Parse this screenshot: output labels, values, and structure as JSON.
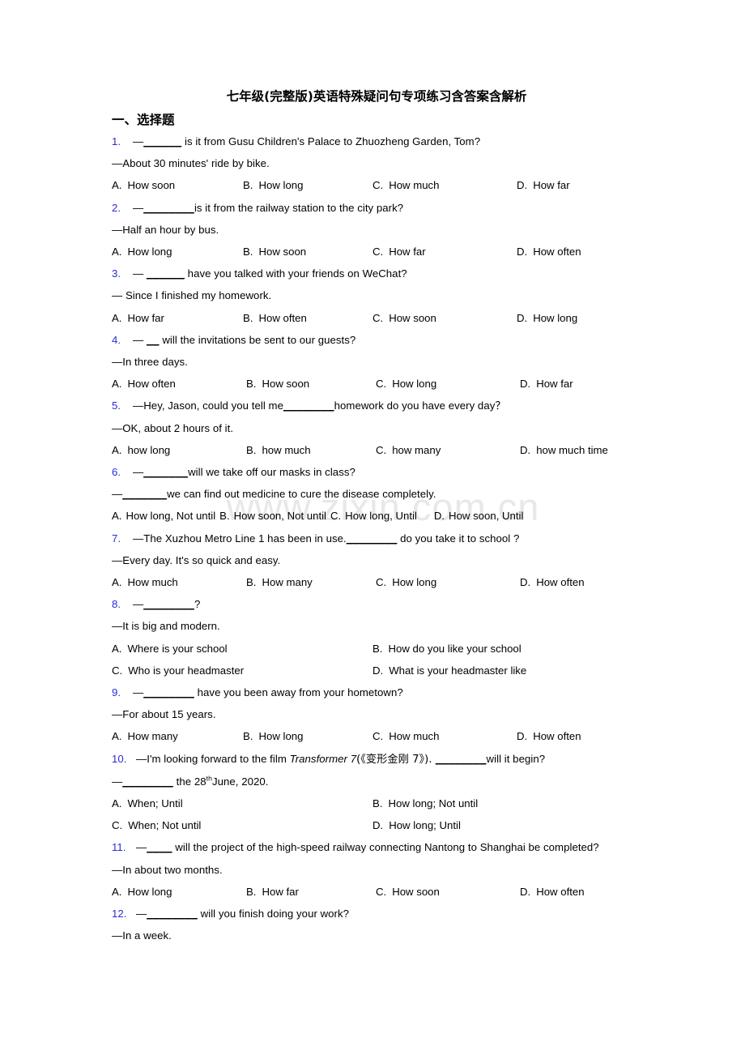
{
  "document": {
    "title": "七年级(完整版)英语特殊疑问句专项练习含答案含解析",
    "section_heading": "一、选择题",
    "watermark": "www.zixin.com.cn",
    "accent_color": "#2b2bd4"
  },
  "questions": [
    {
      "number": "1.",
      "stem": "—______ is it from Gusu Children's Palace to Zhuozheng Garden, Tom?",
      "stem_prefix": "—",
      "stem_blank": "______",
      "stem_rest": " is it from Gusu Children's Palace to Zhuozheng Garden, Tom?",
      "answer_line": "—About 30 minutes' ride by bike.",
      "layout": "four-column",
      "options": [
        {
          "label": "A.",
          "text": "How soon"
        },
        {
          "label": "B.",
          "text": "How long"
        },
        {
          "label": "C.",
          "text": "How much"
        },
        {
          "label": "D.",
          "text": "How far"
        }
      ]
    },
    {
      "number": "2.",
      "stem_prefix": "—",
      "stem_blank": "________",
      "stem_rest": "is it from the railway station to the city park?",
      "answer_line": "—Half an hour by bus.",
      "layout": "four-column",
      "options": [
        {
          "label": "A.",
          "text": "How long"
        },
        {
          "label": "B.",
          "text": "How soon"
        },
        {
          "label": "C.",
          "text": "How far"
        },
        {
          "label": "D.",
          "text": "How often"
        }
      ]
    },
    {
      "number": "3.",
      "stem_prefix": "— ",
      "stem_blank": "______",
      "stem_rest": " have you talked with your friends on WeChat?",
      "answer_line": "— Since I finished my homework.",
      "layout": "four-column",
      "options": [
        {
          "label": "A.",
          "text": "How far"
        },
        {
          "label": "B.",
          "text": "How often"
        },
        {
          "label": "C.",
          "text": "How soon"
        },
        {
          "label": "D.",
          "text": "How long"
        }
      ]
    },
    {
      "number": "4.",
      "stem_prefix": "— ",
      "stem_blank": "__",
      "stem_rest": " will the invitations be sent to our guests?",
      "answer_line": "—In three days.",
      "layout": "four-column-indent",
      "options": [
        {
          "label": "A.",
          "text": "How often"
        },
        {
          "label": "B.",
          "text": "How soon"
        },
        {
          "label": "C.",
          "text": "How long"
        },
        {
          "label": "D.",
          "text": "How far"
        }
      ]
    },
    {
      "number": "5.",
      "stem_prefix": "—Hey, Jason, could you tell me",
      "stem_blank": "________",
      "stem_rest": "homework do you have every day？",
      "answer_line": "—OK, about 2 hours of it.",
      "layout": "four-column-indent",
      "options": [
        {
          "label": "A.",
          "text": "how long"
        },
        {
          "label": "B.",
          "text": "how much"
        },
        {
          "label": "C.",
          "text": "how many"
        },
        {
          "label": "D.",
          "text": "how much time"
        }
      ]
    },
    {
      "number": "6.",
      "stem_prefix": "—",
      "stem_blank": "_______",
      "stem_rest": "will we take off our masks in class?",
      "answer_prefix": "—",
      "answer_blank": "_______",
      "answer_rest": "we can find out medicine to cure the disease completely.",
      "layout": "flow",
      "options": [
        {
          "label": "A.",
          "text": "How long, Not until"
        },
        {
          "label": "B.",
          "text": "How soon, Not until"
        },
        {
          "label": "C.",
          "text": "How long, Until"
        },
        {
          "label": "D.",
          "text": "How soon, Until"
        }
      ]
    },
    {
      "number": "7.",
      "stem_prefix": "—The Xuzhou Metro Line 1 has been in use.",
      "stem_blank": "________",
      "stem_rest": " do you take it to school ?",
      "answer_line": "—Every day. It's so quick and easy.",
      "layout": "four-column-indent",
      "options": [
        {
          "label": "A.",
          "text": "How much"
        },
        {
          "label": "B.",
          "text": "How many"
        },
        {
          "label": "C.",
          "text": "How long"
        },
        {
          "label": "D.",
          "text": "How often"
        }
      ]
    },
    {
      "number": "8.",
      "stem_prefix": "—",
      "stem_blank": "________",
      "stem_rest": "?",
      "answer_line": "—It is big and modern.",
      "layout": "two-column",
      "options": [
        {
          "label": "A.",
          "text": "Where is your school"
        },
        {
          "label": "B.",
          "text": "How do you like your school"
        },
        {
          "label": "C.",
          "text": "Who is your headmaster"
        },
        {
          "label": "D.",
          "text": "What is your headmaster like"
        }
      ]
    },
    {
      "number": "9.",
      "stem_prefix": "—",
      "stem_blank": "________",
      "stem_rest": " have you been away from your hometown?",
      "answer_line": "—For about 15 years.",
      "layout": "four-column",
      "options": [
        {
          "label": "A.",
          "text": "How many"
        },
        {
          "label": "B.",
          "text": "How long"
        },
        {
          "label": "C.",
          "text": "How much"
        },
        {
          "label": "D.",
          "text": "How often"
        }
      ]
    },
    {
      "number": "10.",
      "stem_a": "—I'm looking forward to the film ",
      "stem_italic": "Transformer 7",
      "stem_b": "(《变形金刚 7》). ",
      "stem_blank": "________",
      "stem_rest": "will it begin?",
      "answer_prefix": "—",
      "answer_blank": "________",
      "answer_mid": " the 28",
      "answer_sup": "th",
      "answer_tail": "June, 2020.",
      "layout": "two-column",
      "options": [
        {
          "label": "A.",
          "text": "When; Until"
        },
        {
          "label": "B.",
          "text": "How long; Not until"
        },
        {
          "label": "C.",
          "text": "When; Not until"
        },
        {
          "label": "D.",
          "text": "How long; Until"
        }
      ]
    },
    {
      "number": "11.",
      "stem_prefix": "—",
      "stem_blank": "____",
      "stem_rest": " will the project of the high-speed railway connecting Nantong to Shanghai be completed?",
      "answer_line": "—In about two months.",
      "layout": "four-column-indent",
      "options": [
        {
          "label": "A.",
          "text": "How long"
        },
        {
          "label": "B.",
          "text": "How far"
        },
        {
          "label": "C.",
          "text": "How soon"
        },
        {
          "label": "D.",
          "text": "How often"
        }
      ]
    },
    {
      "number": "12.",
      "stem_prefix": "—",
      "stem_blank": "________",
      "stem_rest": " will you finish doing your work?",
      "answer_line": "—In a week.",
      "layout": "none",
      "options": []
    }
  ]
}
